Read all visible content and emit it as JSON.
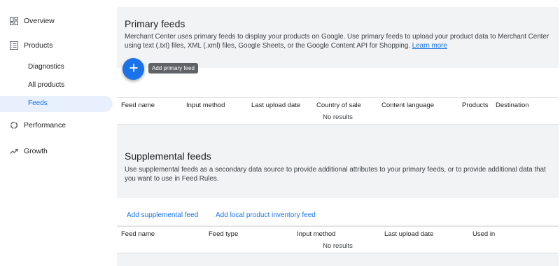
{
  "sidebar": {
    "items": [
      {
        "label": "Overview",
        "icon": "dashboard-icon"
      },
      {
        "label": "Products",
        "icon": "products-list-icon"
      },
      {
        "label": "Performance",
        "icon": "performance-donut-icon"
      },
      {
        "label": "Growth",
        "icon": "trending-up-icon"
      }
    ],
    "subitems": [
      {
        "label": "Diagnostics"
      },
      {
        "label": "All products"
      },
      {
        "label": "Feeds",
        "active": true
      }
    ]
  },
  "primary": {
    "title": "Primary feeds",
    "description": "Merchant Center uses primary feeds to display your products on Google. Use primary feeds to upload your product data to Merchant Center using text (.txt) files, XML (.xml) files, Google Sheets, or the Google Content API for Shopping.",
    "learn_more": "Learn more",
    "add_tooltip": "Add primary feed",
    "columns": [
      "Feed name",
      "Input method",
      "Last upload date",
      "Country of sale",
      "Content language",
      "Products",
      "Destination"
    ],
    "empty_text": "No results"
  },
  "supplemental": {
    "title": "Supplemental feeds",
    "description": "Use supplemental feeds as a secondary data source to provide additional attributes to your primary feeds, or to provide additional data that you want to use in Feed Rules.",
    "add_supplemental": "Add supplemental feed",
    "add_local_inventory": "Add local product inventory feed",
    "columns": [
      "Feed name",
      "Feed type",
      "Input method",
      "Last upload date",
      "Used in"
    ],
    "empty_text": "No results"
  },
  "colors": {
    "accent": "#1a73e8",
    "active_bg": "#e8f0fe",
    "panel_bg": "#f1f3f4",
    "tooltip_bg": "#5f6368"
  }
}
